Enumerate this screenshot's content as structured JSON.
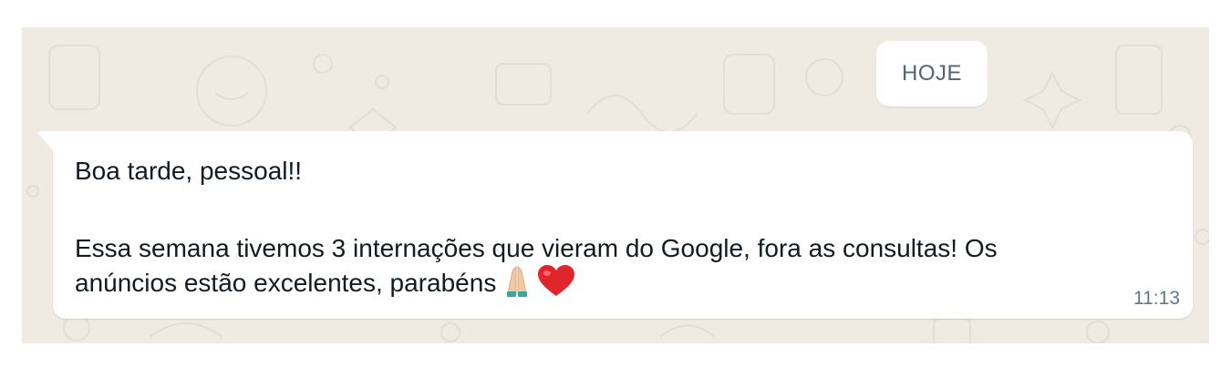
{
  "chat": {
    "date_label": "HOJE",
    "message": {
      "line1": "Boa tarde, pessoal!!",
      "line2": "Essa semana tivemos 3 internações que vieram do Google, fora as consultas! Os",
      "line3": "anúncios estão excelentes, parabéns",
      "emojis": [
        "folded-hands-icon",
        "red-heart-icon"
      ],
      "time": "11:13"
    }
  },
  "colors": {
    "wallpaper": "#efeae2",
    "bubble": "#ffffff",
    "text": "#111b21",
    "meta": "#667781",
    "heart": "#e0262a"
  }
}
